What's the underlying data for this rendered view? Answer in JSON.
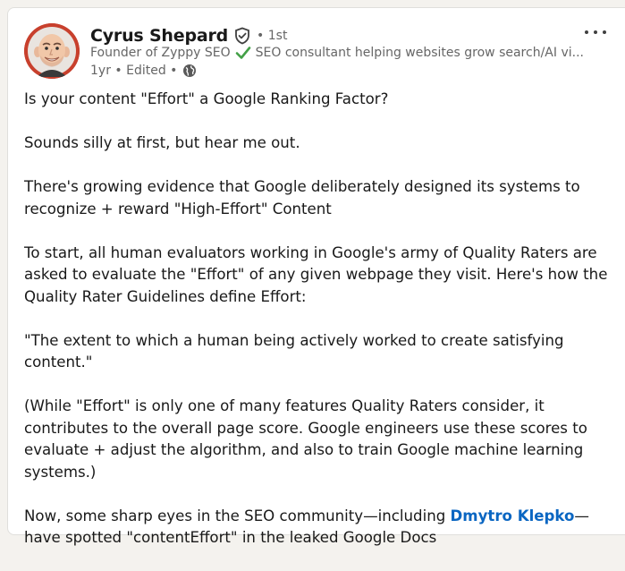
{
  "author": {
    "name": "Cyrus Shepard",
    "degree": "• 1st",
    "headline_role": "Founder of Zyppy SEO",
    "headline_tagline": "SEO consultant helping websites grow search/AI vi...",
    "meta_time": "1yr • Edited •",
    "verified_icon": "verified-shield-icon",
    "check_color": "#43a047"
  },
  "post": {
    "p1": "Is your content \"Effort\" a Google Ranking Factor?",
    "p2": "Sounds silly at first, but hear me out.",
    "p3": "There's growing evidence that Google deliberately designed its systems to recognize + reward \"High-Effort\" Content",
    "p4": "To start, all human evaluators working in Google's army of Quality Raters are asked to evaluate the \"Effort\" of any given webpage they visit. Here's how the Quality Rater Guidelines define Effort:",
    "p5": "\"The extent to which a human being actively worked to create satisfying content.\"",
    "p6": "(While \"Effort\" is only one of many features Quality Raters consider, it contributes to the overall page score. Google engineers use these scores to evaluate + adjust the algorithm, and also to train Google machine learning systems.)",
    "p7_before": "Now, some sharp eyes in the SEO community—including ",
    "p7_mention": "Dmytro Klepko",
    "p7_after": "—have spotted \"contentEffort\" in the leaked Google Docs"
  },
  "colors": {
    "link": "#0a66c2",
    "text": "#191919",
    "muted": "#666666"
  }
}
